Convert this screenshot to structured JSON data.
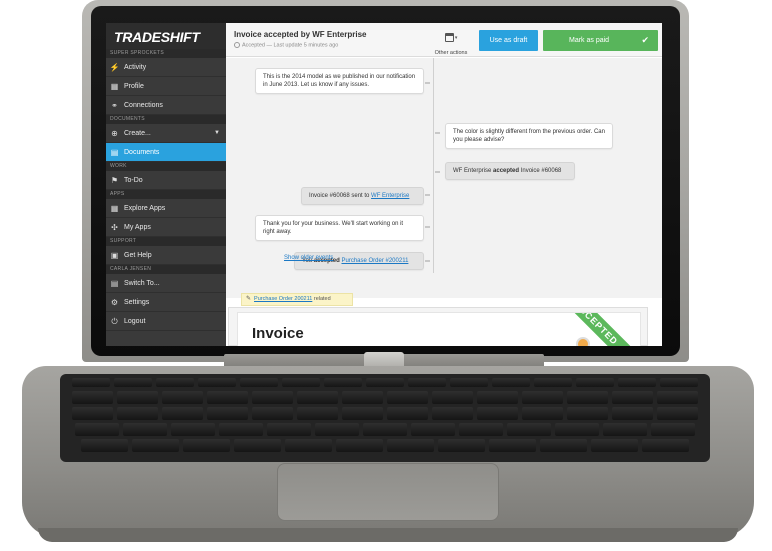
{
  "sidebar": {
    "logo": "TRADESHIFT",
    "sections": [
      {
        "title": "SUPER SPROCKETS",
        "items": [
          {
            "label": "Activity",
            "icon": "activity-icon"
          },
          {
            "label": "Profile",
            "icon": "profile-icon"
          },
          {
            "label": "Connections",
            "icon": "connections-icon"
          }
        ]
      },
      {
        "title": "DOCUMENTS",
        "items": [
          {
            "label": "Create...",
            "icon": "create-icon"
          },
          {
            "label": "Documents",
            "icon": "documents-icon",
            "active": true
          }
        ]
      },
      {
        "title": "WORK",
        "items": [
          {
            "label": "To-Do",
            "icon": "flag-icon"
          }
        ]
      },
      {
        "title": "APPS",
        "items": [
          {
            "label": "Explore Apps",
            "icon": "apps-grid-icon"
          },
          {
            "label": "My Apps",
            "icon": "my-apps-icon"
          }
        ]
      },
      {
        "title": "SUPPORT",
        "items": [
          {
            "label": "Get Help",
            "icon": "help-icon"
          }
        ]
      },
      {
        "title": "CARLA JENSEN",
        "items": [
          {
            "label": "Switch To...",
            "icon": "switch-icon"
          },
          {
            "label": "Settings",
            "icon": "gear-icon"
          },
          {
            "label": "Logout",
            "icon": "power-icon"
          }
        ]
      }
    ]
  },
  "header": {
    "title": "Invoice accepted by WF Enterprise",
    "subtitle": "Accepted — Last update 5 minutes ago",
    "other_actions": "Other actions",
    "use_as_draft": "Use as draft",
    "mark_as_paid": "Mark as paid"
  },
  "timeline": {
    "msg1": "This is the 2014 model as we published in our notification in June 2013. Let us know if any issues.",
    "msg2": "The color is slightly different from the previous order. Can you please advise?",
    "event1_pre": "WF Enterprise ",
    "event1_bold": "accepted",
    "event1_post": " Invoice #60068",
    "event2_pre": "Invoice #60068 sent to ",
    "event2_link": "WF Enterprise",
    "msg3": "Thank you for your business. We'll start working on it right away.",
    "event3_pre": "You ",
    "event3_bold": "accepted",
    "event3_link": "Purchase Order #200211",
    "show_older": "Show older events"
  },
  "related": {
    "link": "Purchase Order 200211",
    "suffix": " related"
  },
  "invoice": {
    "title": "Invoice",
    "stamp": "ACCEPTED"
  },
  "colors": {
    "accent_blue": "#2aa2de",
    "accent_green": "#58b55b",
    "sidebar_bg": "#3a3a3a"
  }
}
